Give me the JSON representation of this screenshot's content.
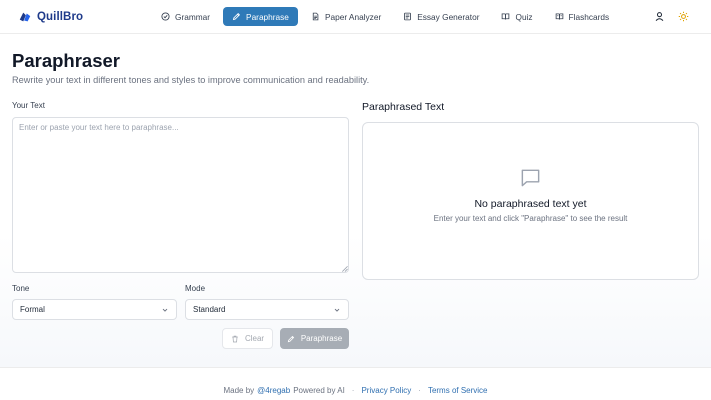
{
  "brand": {
    "name": "QuillBro"
  },
  "nav": {
    "items": [
      {
        "label": "Grammar",
        "icon": "check-circle-icon",
        "active": false
      },
      {
        "label": "Paraphrase",
        "icon": "pencil-icon",
        "active": true
      },
      {
        "label": "Paper Analyzer",
        "icon": "document-icon",
        "active": false
      },
      {
        "label": "Essay Generator",
        "icon": "essay-icon",
        "active": false
      },
      {
        "label": "Quiz",
        "icon": "book-icon",
        "active": false
      },
      {
        "label": "Flashcards",
        "icon": "flashcards-icon",
        "active": false
      }
    ]
  },
  "header": {
    "title": "Paraphraser",
    "subtitle": "Rewrite your text in different tones and styles to improve communication and readability."
  },
  "input": {
    "label": "Your Text",
    "value": "",
    "placeholder": "Enter or paste your text here to paraphrase..."
  },
  "result": {
    "heading": "Paraphrased Text",
    "empty_title": "No paraphrased text yet",
    "empty_subtitle": "Enter your text and click \"Paraphrase\" to see the result"
  },
  "tone": {
    "label": "Tone",
    "value": "Formal"
  },
  "mode": {
    "label": "Mode",
    "value": "Standard"
  },
  "actions": {
    "clear_label": "Clear",
    "paraphrase_label": "Paraphrase"
  },
  "footer": {
    "made_by": "Made by",
    "author": "@4regab",
    "powered": "Powered by AI",
    "privacy": "Privacy Policy",
    "terms": "Terms of Service",
    "separator": "·"
  },
  "colors": {
    "accent": "#2f7ab8",
    "brand": "#1e3a8a",
    "disabled_button": "#a7adb5"
  }
}
